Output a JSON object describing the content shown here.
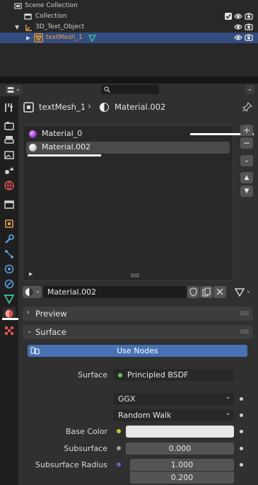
{
  "outliner": {
    "rows": [
      {
        "label": "Scene Collection"
      },
      {
        "label": "Collection"
      },
      {
        "label": "3D_Text_Object"
      },
      {
        "label": "textMesh_1"
      }
    ]
  },
  "breadcrumb": {
    "object": "textMesh_1",
    "separator": "›",
    "material": "Material.002"
  },
  "material_slots": {
    "items": [
      {
        "label": "Material_0",
        "color": "#9c3fd6"
      },
      {
        "label": "Material.002",
        "color": "#dcdcdc"
      }
    ],
    "add": "+",
    "remove": "−"
  },
  "material_field": {
    "value": "Material.002"
  },
  "panels": {
    "preview": "Preview",
    "surface": "Surface"
  },
  "surface": {
    "use_nodes": "Use Nodes",
    "surface_label": "Surface",
    "surface_value": "Principled BSDF",
    "distribution": "GGX",
    "subsurface_method": "Random Walk",
    "base_color_label": "Base Color",
    "subsurface_label": "Subsurface",
    "subsurface_value": "0.000",
    "subsurface_radius_label": "Subsurface Radius",
    "radius_values": [
      "1.000",
      "0.200"
    ]
  },
  "colors": {
    "selected_row": "#334d80",
    "accent_orange": "#e0a050",
    "use_nodes_blue": "#4772b3",
    "node_green": "#61c86a",
    "socket_yellow": "#c7c729",
    "socket_grey": "#a1a1a1",
    "socket_purple": "#6363c7"
  }
}
